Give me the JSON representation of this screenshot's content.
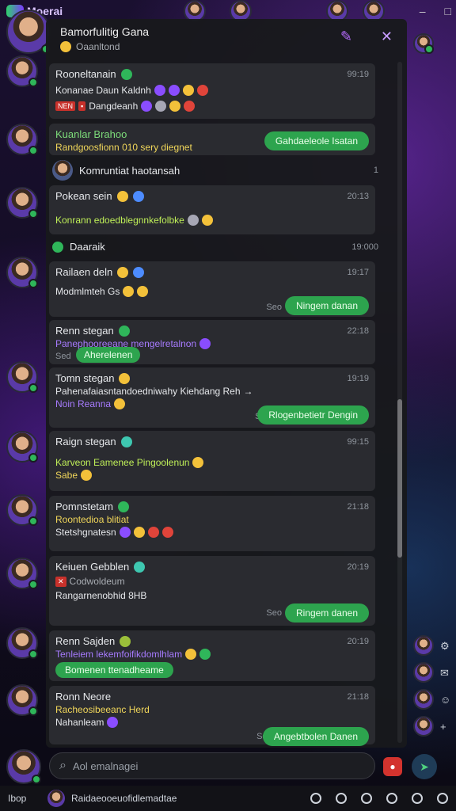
{
  "app": {
    "brand": "Moerai"
  },
  "panel": {
    "title": "Bamorfulitig Gana",
    "subtitle": "Oaanltond",
    "messages": [
      {
        "name": "Rooneltanain",
        "time": "99:19",
        "lines": [
          "Konanae Daun Kaldnh",
          "Dangdeanh"
        ],
        "tag": "NEN"
      },
      {
        "name": "Kuanlar Brahoo",
        "line": "Randgoosfionn 010 sery diegnet",
        "meta": "1",
        "action": "Gahdaeleole Isatan"
      },
      {
        "name": "Pokean sein",
        "time": "20:13",
        "line": "Konrann edoedblegnnkefolbke"
      },
      {
        "name": "Railaen deln",
        "time": "19:17",
        "line": "Modmlmteh Gs",
        "meta": "Seo",
        "action": "Ningem danan"
      },
      {
        "name": "Renn stegan",
        "time": "22:18",
        "line": "Panephooreeane mengelretalnon",
        "meta": "Sed",
        "action": "Aherelenen"
      },
      {
        "name": "Tomn stegan",
        "time": "19:19",
        "line1": "Pahenafaiasntandoedniwahy Kiehdang Reh",
        "line2": "Noin Reanna",
        "meta": "Sel",
        "action": "Rlogenbetietr Dengin"
      },
      {
        "name": "Raign stegan",
        "time": "99:15",
        "line1": "Karveon Eamenee Pingoolenun",
        "line2": "Sabe"
      },
      {
        "name": "Pomnstetam",
        "time": "21:18",
        "line1": "Roontedioa blitiat",
        "line2": "Stetshgnatesn"
      },
      {
        "name": "Keiuen Gebblen",
        "time": "20:19",
        "line1": "Codwoldeum",
        "line2": "Rangarnenobhid 8HB",
        "meta": "Seo",
        "action": "Ringem danen"
      },
      {
        "name": "Renn Sajden",
        "time": "20:19",
        "line1": "Tenleiem lekemfoifikdomlhlam",
        "action": "Bomenen ttenadheame"
      },
      {
        "name": "Ronn Neore",
        "time": "21:18",
        "line1": "Racheosibeeanc Herd",
        "line2": "Nahanleam",
        "meta": "Sel",
        "action": "Angebtbolen Danen"
      }
    ],
    "sections": [
      {
        "name": "Komruntiat haotansah",
        "count": "1"
      },
      {
        "name": "Daaraik",
        "time": "19:000"
      }
    ]
  },
  "composer": {
    "placeholder": "Aol emalnagei"
  },
  "taskbar": {
    "label": "Ibop",
    "text": "Raidaeooeuofidlemadtae"
  },
  "colors": {
    "accent_green": "#2da44e",
    "accent_purple": "#8a4dff",
    "badge_red": "#c8312b"
  }
}
